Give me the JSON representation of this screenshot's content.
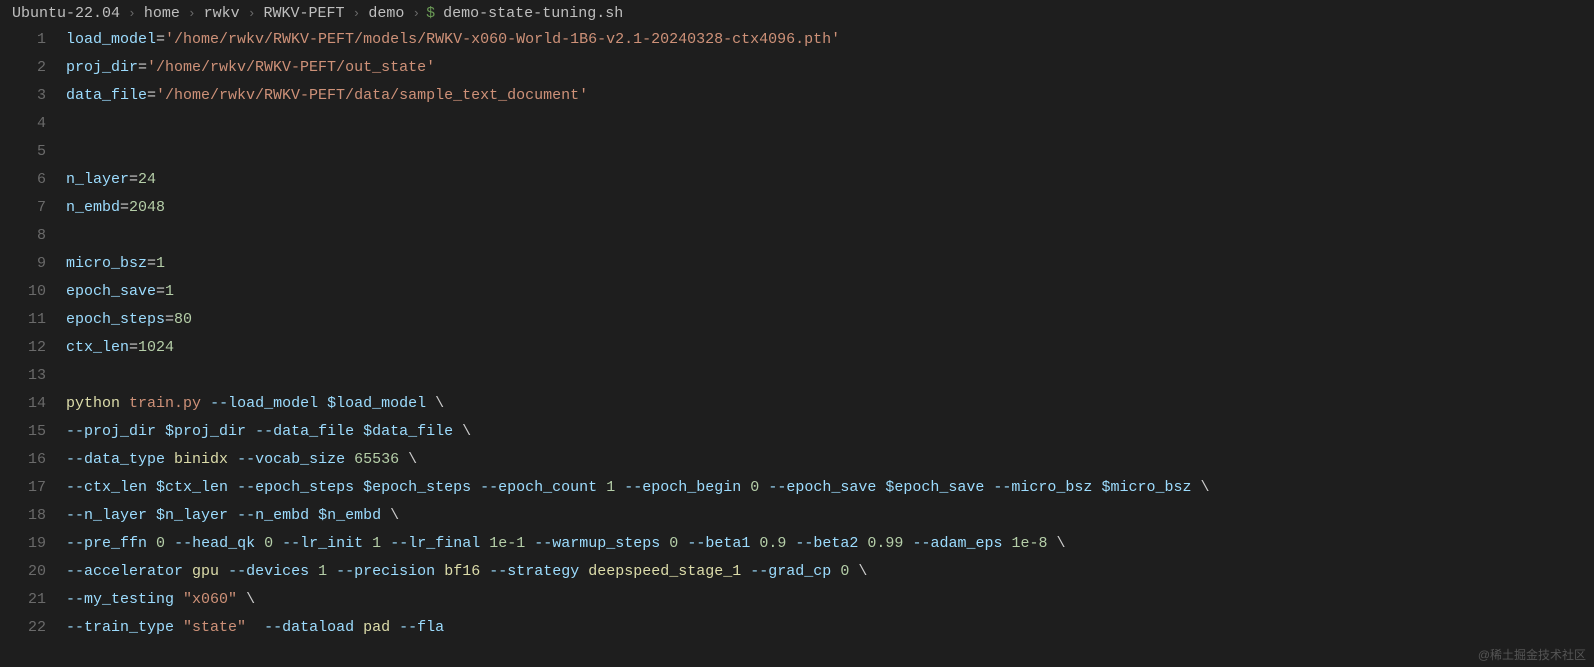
{
  "breadcrumb": {
    "parts": [
      "Ubuntu-22.04",
      "home",
      "rwkv",
      "RWKV-PEFT",
      "demo"
    ],
    "file_icon": "$",
    "file": "demo-state-tuning.sh"
  },
  "watermark": "@稀土掘金技术社区",
  "line_numbers": [
    "1",
    "2",
    "3",
    "4",
    "5",
    "6",
    "7",
    "8",
    "9",
    "10",
    "11",
    "12",
    "13",
    "14",
    "15",
    "16",
    "17",
    "18",
    "19",
    "20",
    "21",
    "22"
  ],
  "lines": [
    [
      {
        "t": "var",
        "v": "load_model"
      },
      {
        "t": "white",
        "v": "="
      },
      {
        "t": "str",
        "v": "'/home/rwkv/RWKV-PEFT/models/RWKV-x060-World-1B6-v2.1-20240328-ctx4096.pth'"
      }
    ],
    [
      {
        "t": "var",
        "v": "proj_dir"
      },
      {
        "t": "white",
        "v": "="
      },
      {
        "t": "str",
        "v": "'/home/rwkv/RWKV-PEFT/out_state'"
      }
    ],
    [
      {
        "t": "var",
        "v": "data_file"
      },
      {
        "t": "white",
        "v": "="
      },
      {
        "t": "str",
        "v": "'/home/rwkv/RWKV-PEFT/data/sample_text_document'"
      }
    ],
    [],
    [],
    [
      {
        "t": "var",
        "v": "n_layer"
      },
      {
        "t": "white",
        "v": "="
      },
      {
        "t": "num",
        "v": "24"
      }
    ],
    [
      {
        "t": "var",
        "v": "n_embd"
      },
      {
        "t": "white",
        "v": "="
      },
      {
        "t": "num",
        "v": "2048"
      }
    ],
    [],
    [
      {
        "t": "var",
        "v": "micro_bsz"
      },
      {
        "t": "white",
        "v": "="
      },
      {
        "t": "num",
        "v": "1"
      }
    ],
    [
      {
        "t": "var",
        "v": "epoch_save"
      },
      {
        "t": "white",
        "v": "="
      },
      {
        "t": "num",
        "v": "1"
      }
    ],
    [
      {
        "t": "var",
        "v": "epoch_steps"
      },
      {
        "t": "white",
        "v": "="
      },
      {
        "t": "num",
        "v": "80"
      }
    ],
    [
      {
        "t": "var",
        "v": "ctx_len"
      },
      {
        "t": "white",
        "v": "="
      },
      {
        "t": "num",
        "v": "1024"
      }
    ],
    [],
    [
      {
        "t": "cmd",
        "v": "python"
      },
      {
        "t": "white",
        "v": " "
      },
      {
        "t": "file",
        "v": "train.py"
      },
      {
        "t": "white",
        "v": " "
      },
      {
        "t": "param",
        "v": "--load_model"
      },
      {
        "t": "white",
        "v": " "
      },
      {
        "t": "var",
        "v": "$load_model"
      },
      {
        "t": "white",
        "v": " \\"
      }
    ],
    [
      {
        "t": "param",
        "v": "--proj_dir"
      },
      {
        "t": "white",
        "v": " "
      },
      {
        "t": "var",
        "v": "$proj_dir"
      },
      {
        "t": "white",
        "v": " "
      },
      {
        "t": "param",
        "v": "--data_file"
      },
      {
        "t": "white",
        "v": " "
      },
      {
        "t": "var",
        "v": "$data_file"
      },
      {
        "t": "white",
        "v": " \\"
      }
    ],
    [
      {
        "t": "param",
        "v": "--data_type"
      },
      {
        "t": "white",
        "v": " "
      },
      {
        "t": "arg",
        "v": "binidx"
      },
      {
        "t": "white",
        "v": " "
      },
      {
        "t": "param",
        "v": "--vocab_size"
      },
      {
        "t": "white",
        "v": " "
      },
      {
        "t": "num",
        "v": "65536"
      },
      {
        "t": "white",
        "v": " \\"
      }
    ],
    [
      {
        "t": "param",
        "v": "--ctx_len"
      },
      {
        "t": "white",
        "v": " "
      },
      {
        "t": "var",
        "v": "$ctx_len"
      },
      {
        "t": "white",
        "v": " "
      },
      {
        "t": "param",
        "v": "--epoch_steps"
      },
      {
        "t": "white",
        "v": " "
      },
      {
        "t": "var",
        "v": "$epoch_steps"
      },
      {
        "t": "white",
        "v": " "
      },
      {
        "t": "param",
        "v": "--epoch_count"
      },
      {
        "t": "white",
        "v": " "
      },
      {
        "t": "num",
        "v": "1"
      },
      {
        "t": "white",
        "v": " "
      },
      {
        "t": "param",
        "v": "--epoch_begin"
      },
      {
        "t": "white",
        "v": " "
      },
      {
        "t": "num",
        "v": "0"
      },
      {
        "t": "white",
        "v": " "
      },
      {
        "t": "param",
        "v": "--epoch_save"
      },
      {
        "t": "white",
        "v": " "
      },
      {
        "t": "var",
        "v": "$epoch_save"
      },
      {
        "t": "white",
        "v": " "
      },
      {
        "t": "param",
        "v": "--micro_bsz"
      },
      {
        "t": "white",
        "v": " "
      },
      {
        "t": "var",
        "v": "$micro_bsz"
      },
      {
        "t": "white",
        "v": " \\"
      }
    ],
    [
      {
        "t": "param",
        "v": "--n_layer"
      },
      {
        "t": "white",
        "v": " "
      },
      {
        "t": "var",
        "v": "$n_layer"
      },
      {
        "t": "white",
        "v": " "
      },
      {
        "t": "param",
        "v": "--n_embd"
      },
      {
        "t": "white",
        "v": " "
      },
      {
        "t": "var",
        "v": "$n_embd"
      },
      {
        "t": "white",
        "v": " \\"
      }
    ],
    [
      {
        "t": "param",
        "v": "--pre_ffn"
      },
      {
        "t": "white",
        "v": " "
      },
      {
        "t": "num",
        "v": "0"
      },
      {
        "t": "white",
        "v": " "
      },
      {
        "t": "param",
        "v": "--head_qk"
      },
      {
        "t": "white",
        "v": " "
      },
      {
        "t": "num",
        "v": "0"
      },
      {
        "t": "white",
        "v": " "
      },
      {
        "t": "param",
        "v": "--lr_init"
      },
      {
        "t": "white",
        "v": " "
      },
      {
        "t": "num",
        "v": "1"
      },
      {
        "t": "white",
        "v": " "
      },
      {
        "t": "param",
        "v": "--lr_final"
      },
      {
        "t": "white",
        "v": " "
      },
      {
        "t": "num",
        "v": "1e-1"
      },
      {
        "t": "white",
        "v": " "
      },
      {
        "t": "param",
        "v": "--warmup_steps"
      },
      {
        "t": "white",
        "v": " "
      },
      {
        "t": "num",
        "v": "0"
      },
      {
        "t": "white",
        "v": " "
      },
      {
        "t": "param",
        "v": "--beta1"
      },
      {
        "t": "white",
        "v": " "
      },
      {
        "t": "num",
        "v": "0.9"
      },
      {
        "t": "white",
        "v": " "
      },
      {
        "t": "param",
        "v": "--beta2"
      },
      {
        "t": "white",
        "v": " "
      },
      {
        "t": "num",
        "v": "0.99"
      },
      {
        "t": "white",
        "v": " "
      },
      {
        "t": "param",
        "v": "--adam_eps"
      },
      {
        "t": "white",
        "v": " "
      },
      {
        "t": "num",
        "v": "1e-8"
      },
      {
        "t": "white",
        "v": " \\"
      }
    ],
    [
      {
        "t": "param",
        "v": "--accelerator"
      },
      {
        "t": "white",
        "v": " "
      },
      {
        "t": "arg",
        "v": "gpu"
      },
      {
        "t": "white",
        "v": " "
      },
      {
        "t": "param",
        "v": "--devices"
      },
      {
        "t": "white",
        "v": " "
      },
      {
        "t": "num",
        "v": "1"
      },
      {
        "t": "white",
        "v": " "
      },
      {
        "t": "param",
        "v": "--precision"
      },
      {
        "t": "white",
        "v": " "
      },
      {
        "t": "arg",
        "v": "bf16"
      },
      {
        "t": "white",
        "v": " "
      },
      {
        "t": "param",
        "v": "--strategy"
      },
      {
        "t": "white",
        "v": " "
      },
      {
        "t": "arg",
        "v": "deepspeed_stage_1"
      },
      {
        "t": "white",
        "v": " "
      },
      {
        "t": "param",
        "v": "--grad_cp"
      },
      {
        "t": "white",
        "v": " "
      },
      {
        "t": "num",
        "v": "0"
      },
      {
        "t": "white",
        "v": " \\"
      }
    ],
    [
      {
        "t": "param",
        "v": "--my_testing"
      },
      {
        "t": "white",
        "v": " "
      },
      {
        "t": "str",
        "v": "\"x060\""
      },
      {
        "t": "white",
        "v": " \\"
      }
    ],
    [
      {
        "t": "param",
        "v": "--train_type"
      },
      {
        "t": "white",
        "v": " "
      },
      {
        "t": "str",
        "v": "\"state\""
      },
      {
        "t": "white",
        "v": "  "
      },
      {
        "t": "param",
        "v": "--dataload"
      },
      {
        "t": "white",
        "v": " "
      },
      {
        "t": "arg",
        "v": "pad"
      },
      {
        "t": "white",
        "v": " "
      },
      {
        "t": "param",
        "v": "--fla"
      }
    ]
  ]
}
